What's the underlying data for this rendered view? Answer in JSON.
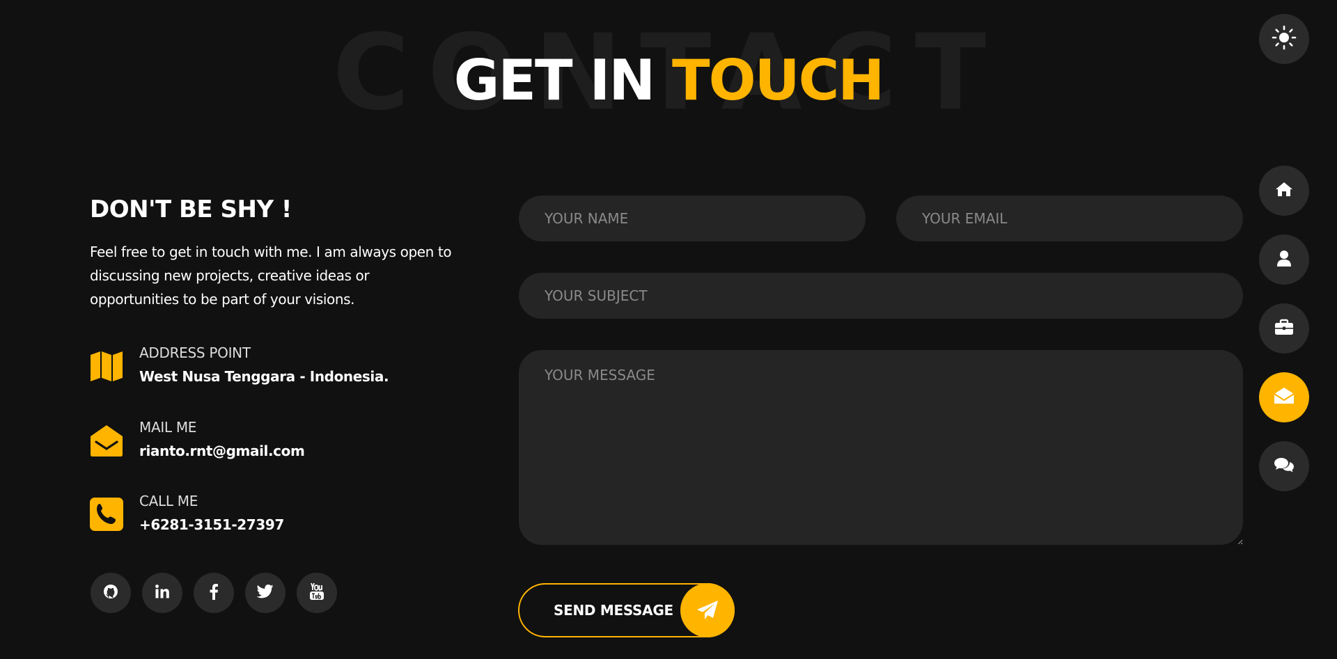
{
  "heading": {
    "background_word": "CONTACT",
    "title_white": "GET IN ",
    "title_accent": "TOUCH"
  },
  "colors": {
    "background": "#111111",
    "accent": "#ffb400",
    "surface": "#252525",
    "button_surface": "#2b2b2b"
  },
  "left": {
    "heading": "DON'T BE SHY !",
    "intro": "Feel free to get in touch with me. I am always open to discussing new projects, creative ideas or opportunities to be part of your visions.",
    "info": [
      {
        "icon": "map-icon",
        "label": "ADDRESS POINT",
        "value": "West Nusa Tenggara - Indonesia."
      },
      {
        "icon": "envelope-open-icon",
        "label": "MAIL ME",
        "value": "rianto.rnt@gmail.com"
      },
      {
        "icon": "phone-icon",
        "label": "CALL ME",
        "value": "+6281-3151-27397"
      }
    ],
    "socials": [
      "github-icon",
      "linkedin-icon",
      "facebook-icon",
      "twitter-icon",
      "youtube-icon"
    ]
  },
  "form": {
    "name_placeholder": "YOUR NAME",
    "email_placeholder": "YOUR EMAIL",
    "subject_placeholder": "YOUR SUBJECT",
    "message_placeholder": "YOUR MESSAGE",
    "send_label": "SEND MESSAGE"
  },
  "nav": {
    "items": [
      "home-icon",
      "user-icon",
      "briefcase-icon",
      "envelope-open-icon",
      "comments-icon"
    ],
    "active": "envelope-open-icon"
  },
  "theme_toggle_icon": "sun-icon"
}
